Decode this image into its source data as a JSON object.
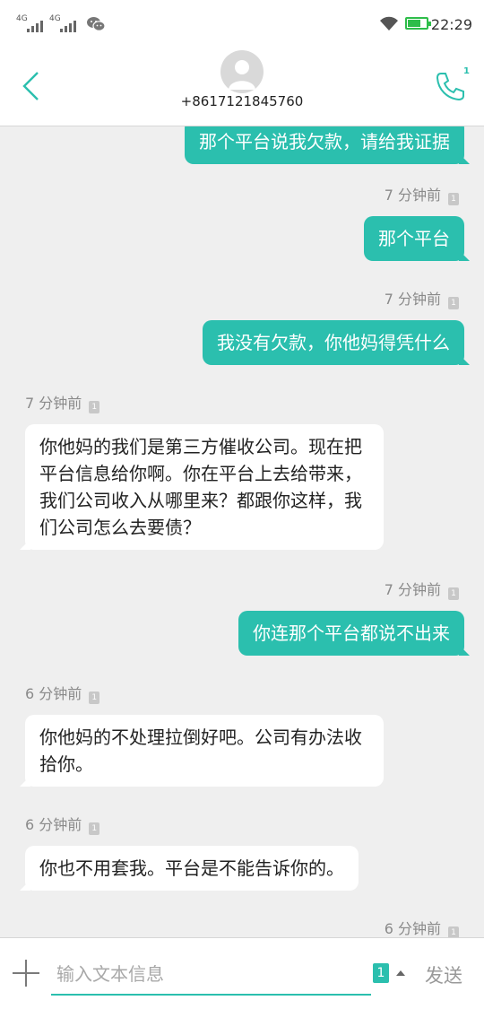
{
  "status_bar": {
    "sim1_label": "4G",
    "sim2_label": "4G",
    "battery_text": "",
    "time": "22:29"
  },
  "header": {
    "contact_number": "+8617121845760",
    "call_sim_label": "1"
  },
  "messages": [
    {
      "direction": "out",
      "timestamp": "",
      "text": "那个平台说我欠款，请给我证据"
    },
    {
      "direction": "out",
      "timestamp": "7 分钟前",
      "sim": "1",
      "text": "那个平台"
    },
    {
      "direction": "out",
      "timestamp": "7 分钟前",
      "sim": "1",
      "text": "我没有欠款，你他妈得凭什么"
    },
    {
      "direction": "in",
      "timestamp": "7 分钟前",
      "sim": "1",
      "text": "你他妈的我们是第三方催收公司。现在把平台信息给你啊。你在平台上去给带来，我们公司收入从哪里来？都跟你这样，我们公司怎么去要债？"
    },
    {
      "direction": "out",
      "timestamp": "7 分钟前",
      "sim": "1",
      "text": "你连那个平台都说不出来"
    },
    {
      "direction": "in",
      "timestamp": "6 分钟前",
      "sim": "1",
      "text": "你他妈的不处理拉倒好吧。公司有办法收拾你。"
    },
    {
      "direction": "in",
      "timestamp": "6 分钟前",
      "sim": "1",
      "text": "你也不用套我。平台是不能告诉你的。"
    },
    {
      "direction": "out",
      "timestamp": "6 分钟前",
      "sim": "1",
      "text": ""
    }
  ],
  "composer": {
    "placeholder": "输入文本信息",
    "sim_selected": "1",
    "send_label": "发送"
  },
  "colors": {
    "accent": "#2bbfae",
    "background": "#efefef",
    "incoming_bubble": "#ffffff",
    "battery": "#2ebd4a"
  },
  "icons": [
    "back-chevron-icon",
    "avatar-placeholder-icon",
    "phone-icon",
    "wifi-icon",
    "wechat-icon",
    "plus-icon",
    "sim-card-icon"
  ]
}
